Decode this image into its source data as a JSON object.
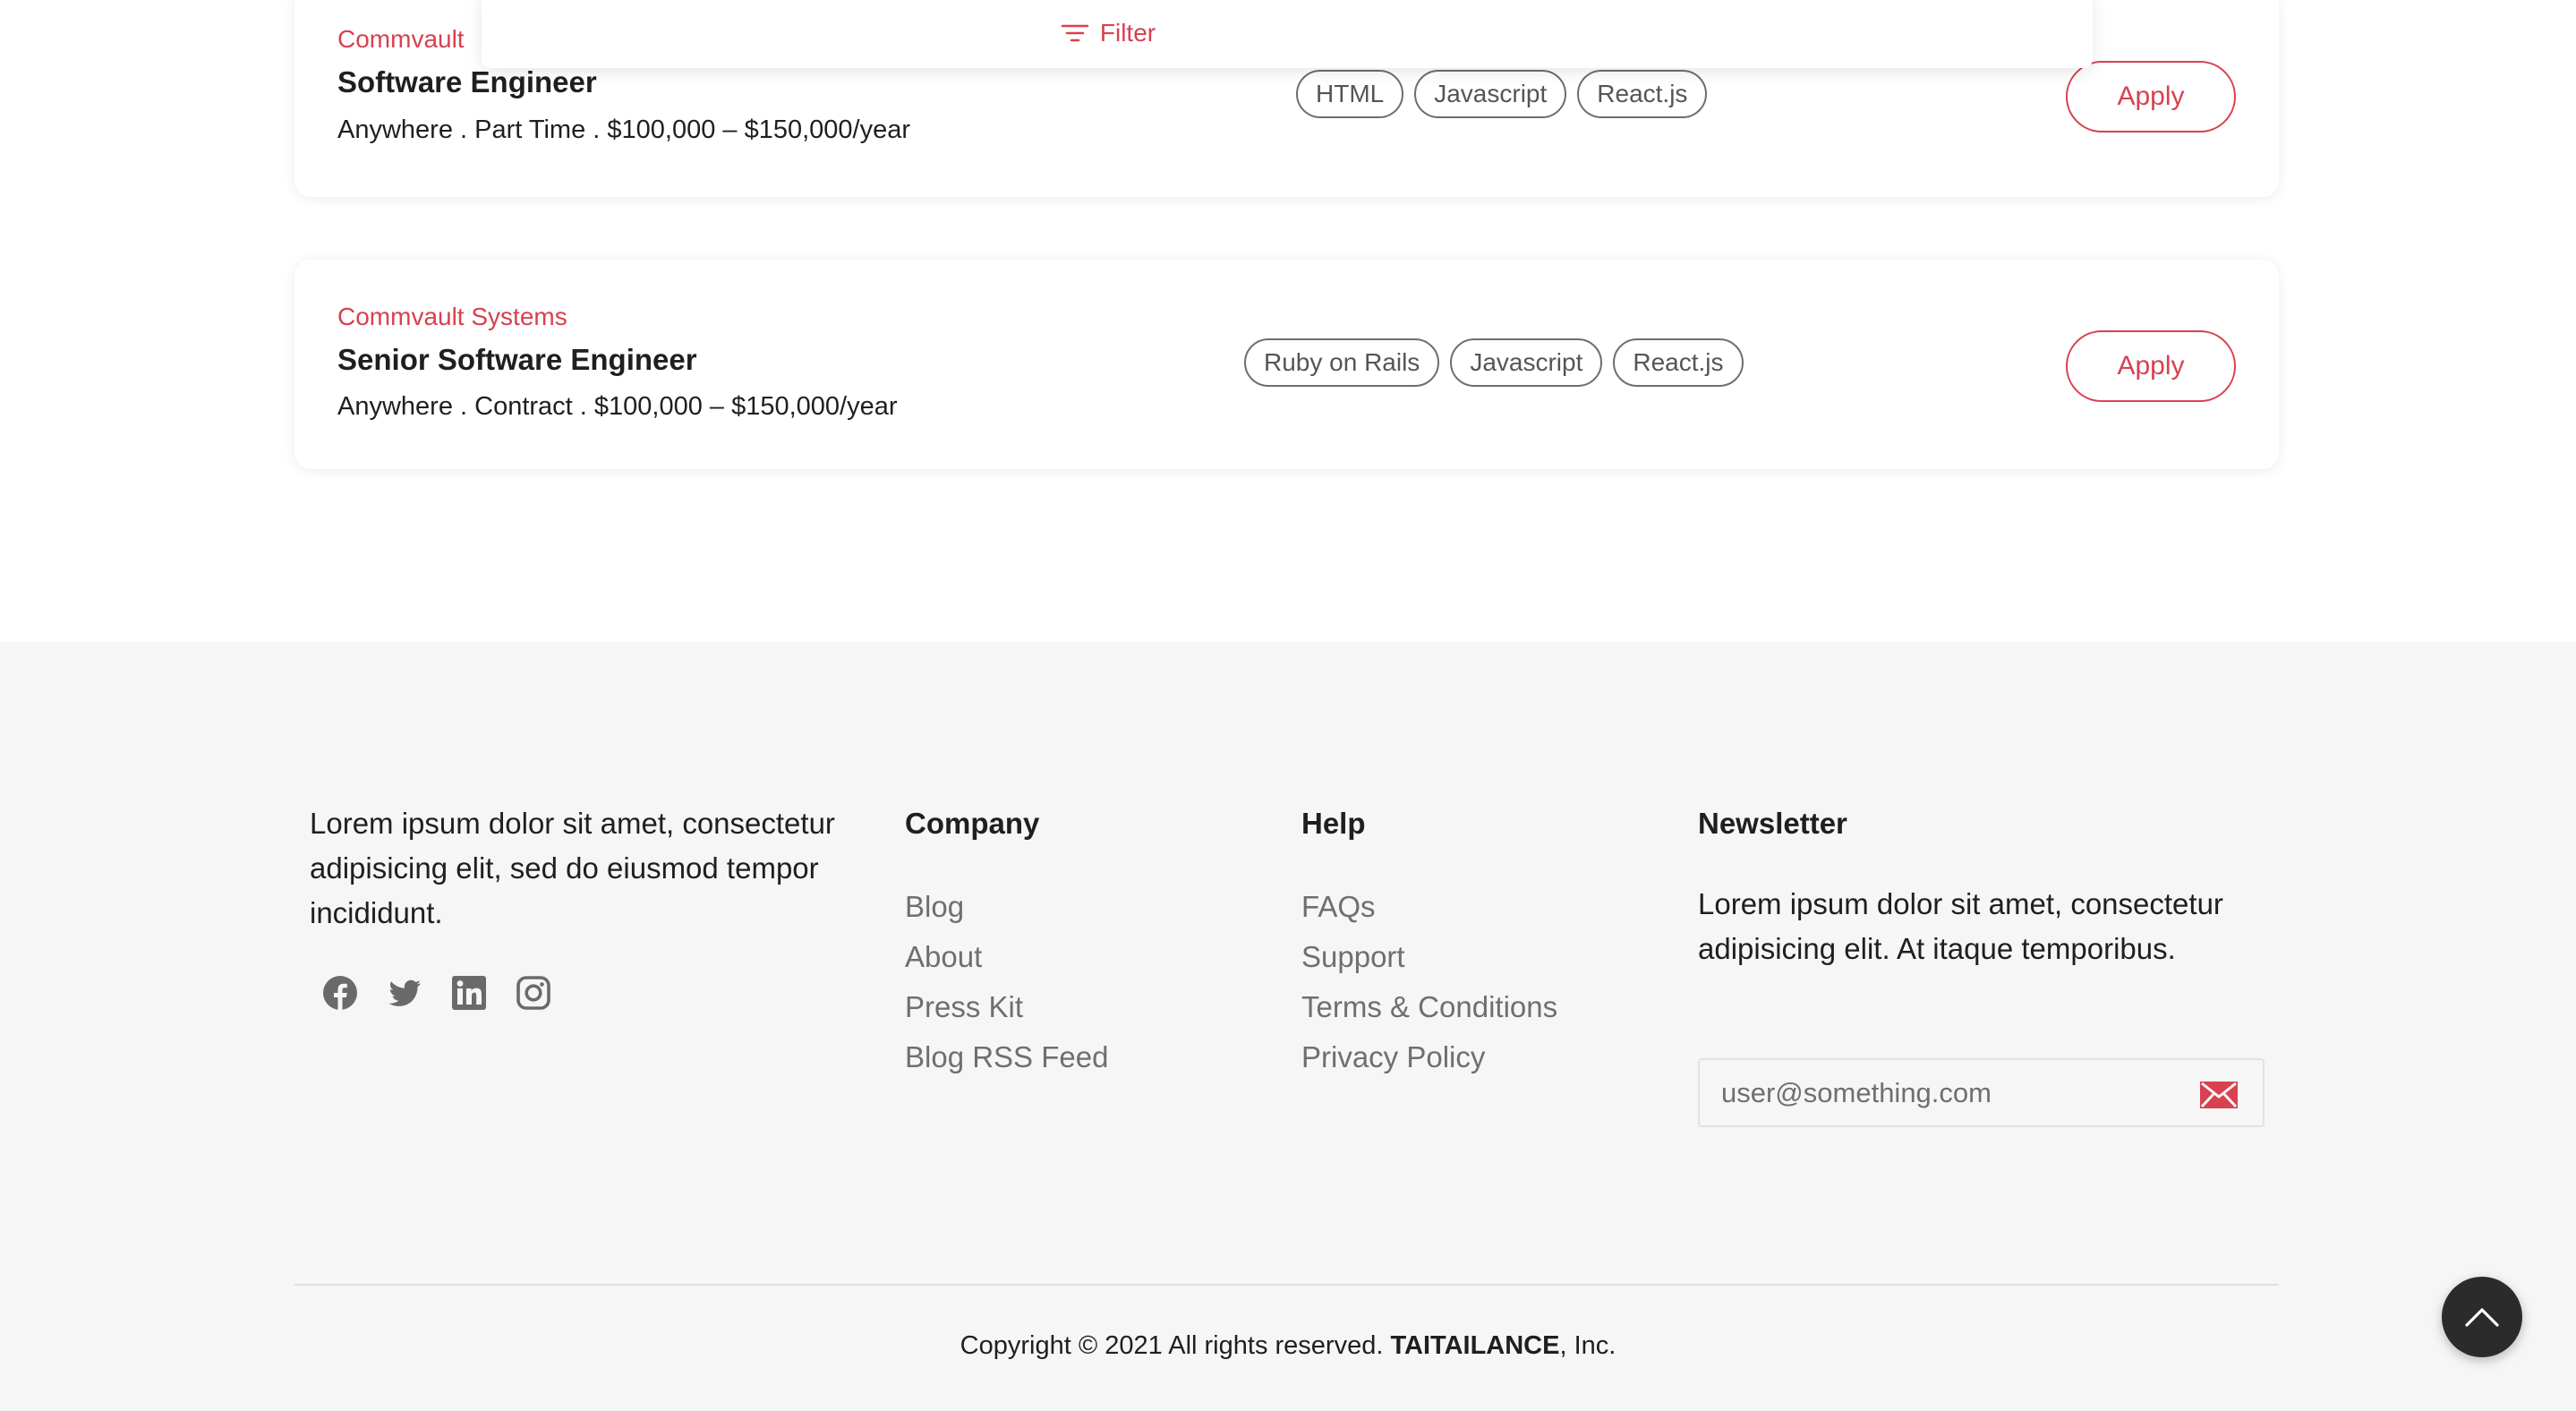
{
  "jobs": [
    {
      "company": "Commvault",
      "title": "Software Engineer",
      "meta": "Anywhere . Part Time . $100,000 – $150,000/year",
      "tags": [
        "HTML",
        "Javascript",
        "React.js"
      ],
      "apply_label": "Apply"
    },
    {
      "company": "Commvault Systems",
      "title": "Senior Software Engineer",
      "meta": "Anywhere . Contract . $100,000 – $150,000/year",
      "tags": [
        "Ruby on Rails",
        "Javascript",
        "React.js"
      ],
      "apply_label": "Apply"
    }
  ],
  "filter": {
    "label": "Filter",
    "icon": "filter-icon"
  },
  "footer": {
    "about": "Lorem ipsum dolor sit amet, consectetur adipisicing elit, sed do eiusmod tempor incididunt.",
    "socials": [
      "facebook-icon",
      "twitter-icon",
      "linkedin-icon",
      "instagram-icon"
    ],
    "company": {
      "heading": "Company",
      "links": [
        "Blog",
        "About",
        "Press Kit",
        "Blog RSS Feed"
      ]
    },
    "help": {
      "heading": "Help",
      "links": [
        "FAQs",
        "Support",
        "Terms & Conditions",
        "Privacy Policy"
      ]
    },
    "newsletter": {
      "heading": "Newsletter",
      "text": "Lorem ipsum dolor sit amet, consectetur adipisicing elit. At itaque temporibus.",
      "placeholder": "user@something.com",
      "value": "",
      "submit_icon": "mail-icon"
    },
    "copyright_prefix": "Copyright © 2021 All rights reserved.",
    "brand": "TAITAILANCE",
    "copyright_suffix": ", Inc."
  },
  "scroll_top_icon": "chevron-up-icon",
  "colors": {
    "accent": "#d8414f",
    "footer_bg": "#f6f6f6",
    "text": "#1f1f1f",
    "muted": "#6f6f6f",
    "scroll_button": "#2b2b2b"
  }
}
